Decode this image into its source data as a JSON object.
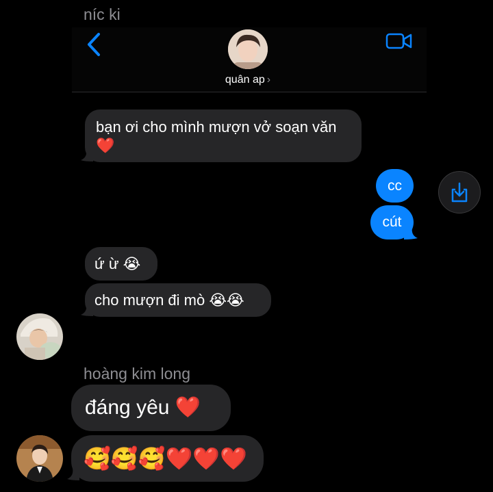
{
  "thread": {
    "top_sender": "níc ki",
    "contact_name": "quân ap",
    "contact_chevron": "›",
    "icons": {
      "back": "chevron-left-icon",
      "video": "video-camera-icon",
      "share": "share-download-icon"
    },
    "accent": "#0a84ff",
    "bubble_gray": "#262628"
  },
  "messages": {
    "m1_line1": "bạn ơi cho mình mượn vở soạn văn",
    "m1_line2": "❤️",
    "m2": "cc",
    "m3": "cút",
    "m4": "ứ ừ 😭",
    "m5": "cho mượn đi mò 😭😭",
    "second_sender": "hoàng kim long",
    "m6": "đáng yêu ❤️",
    "m7": "🥰🥰🥰❤️❤️❤️"
  }
}
